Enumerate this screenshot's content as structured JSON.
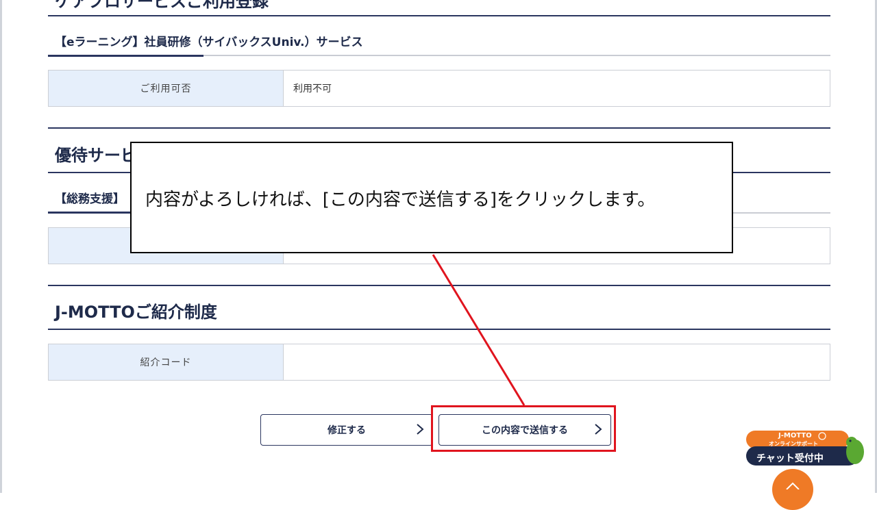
{
  "section_prev": {
    "title": "ケアプロサービスご利用登録"
  },
  "elearning": {
    "subtitle": "【eラーニング】社員研修（サイバックスUniv.）サービス",
    "row_label": "ご利用可否",
    "row_value": "利用不可"
  },
  "perks": {
    "title": "優待サービス",
    "subtitle": "【総務支援】"
  },
  "referral": {
    "title": "J-MOTTOご紹介制度",
    "row_label": "紹介コード",
    "row_value": ""
  },
  "actions": {
    "edit_label": "修正する",
    "submit_label": "この内容で送信する"
  },
  "callout": {
    "text": "内容がよろしければ、[この内容で送信する]をクリックします。"
  },
  "chat_widget": {
    "brand": "J-MOTTO",
    "subtitle": "オンラインサポート",
    "status": "チャット受付中"
  },
  "colors": {
    "navy": "#2a355f",
    "label_bg": "#e6effb",
    "highlight_red": "#e0141e",
    "chat_orange": "#ef7a26",
    "chat_navy": "#1e2a4a"
  },
  "icons": [
    "chevron-right-icon",
    "chat-bubble-icon",
    "dinosaur-mascot-icon",
    "chevron-up-icon"
  ]
}
